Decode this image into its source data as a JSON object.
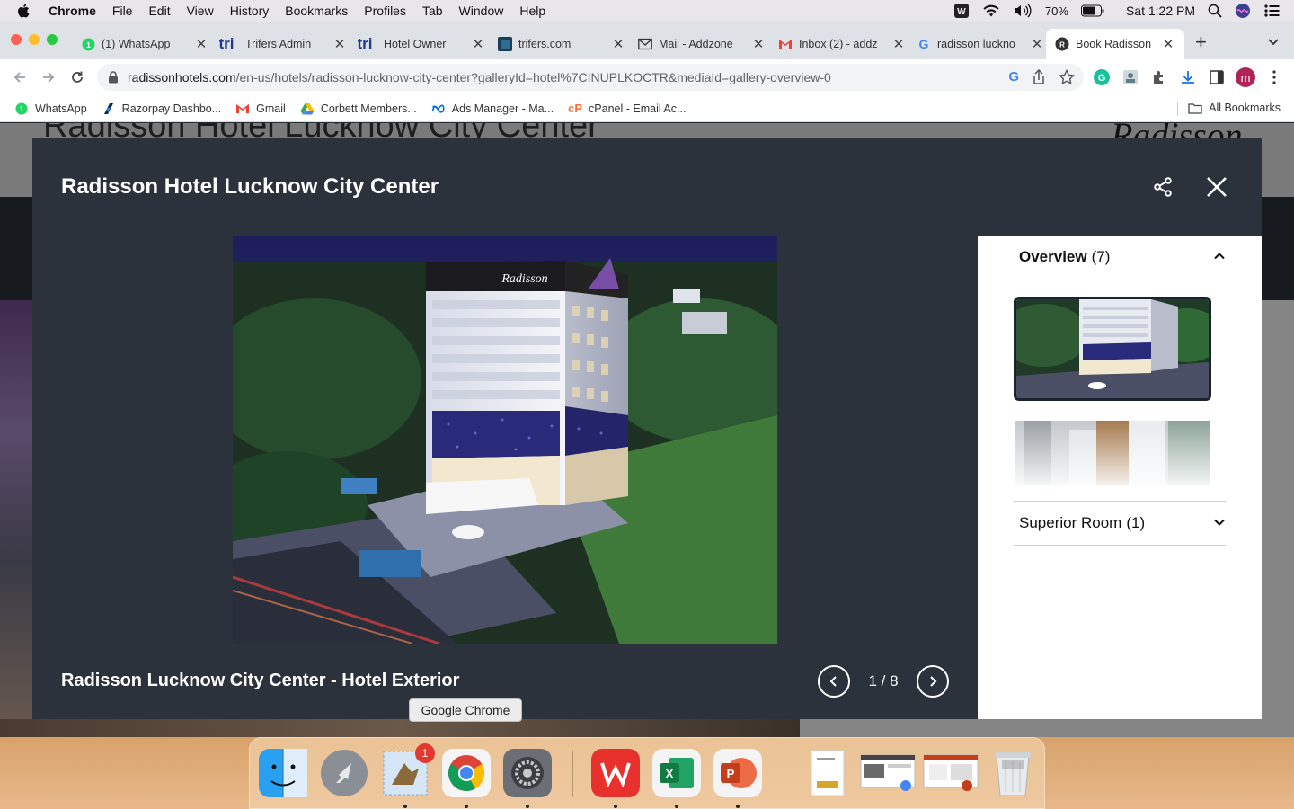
{
  "menubar": {
    "app": "Chrome",
    "items": [
      "File",
      "Edit",
      "View",
      "History",
      "Bookmarks",
      "Profiles",
      "Tab",
      "Window",
      "Help"
    ],
    "battery": "70%",
    "clock": "Sat 1:22 PM"
  },
  "tabs": [
    {
      "label": "(1) WhatsApp",
      "icon": "whatsapp-icon"
    },
    {
      "label": "Trifers Admin",
      "icon": "trifers-icon"
    },
    {
      "label": "Hotel Owner",
      "icon": "trifers-icon"
    },
    {
      "label": "trifers.com",
      "icon": "trifers-site-icon"
    },
    {
      "label": "Mail - Addzone",
      "icon": "mail-icon"
    },
    {
      "label": "Inbox (2) - addz",
      "icon": "gmail-icon"
    },
    {
      "label": "radisson luckno",
      "icon": "google-icon"
    },
    {
      "label": "Book Radisson",
      "icon": "radisson-icon",
      "active": true
    }
  ],
  "toolbar": {
    "url_host": "radissonhotels.com",
    "url_path": "/en-us/hotels/radisson-lucknow-city-center?galleryId=hotel%7CINUPLKOCTR&mediaId=gallery-overview-0",
    "profile_initial": "m"
  },
  "bookmarks": [
    {
      "label": "WhatsApp",
      "icon": "whatsapp-icon"
    },
    {
      "label": "Razorpay Dashbo...",
      "icon": "razorpay-icon"
    },
    {
      "label": "Gmail",
      "icon": "gmail-icon"
    },
    {
      "label": "Corbett Members...",
      "icon": "google-drive-icon"
    },
    {
      "label": "Ads Manager - Ma...",
      "icon": "meta-icon"
    },
    {
      "label": "cPanel - Email Ac...",
      "icon": "cpanel-icon"
    }
  ],
  "all_bookmarks": "All Bookmarks",
  "background_page": {
    "title": "Radisson Hotel Lucknow City Center",
    "logo": "Radisson"
  },
  "modal": {
    "title": "Radisson Hotel Lucknow City Center",
    "photo_sign": "Radisson",
    "caption": "Radisson Lucknow City Center - Hotel Exterior",
    "counter": "1 / 8",
    "sections": [
      {
        "name": "Overview",
        "count": "(7)",
        "expanded": true
      },
      {
        "name": "Superior Room",
        "count": "(1)",
        "expanded": false
      }
    ]
  },
  "tooltip": "Google Chrome",
  "dock": {
    "apps": [
      "Finder",
      "Launchpad",
      "Mail",
      "Google Chrome",
      "System Preferences",
      "WPS Office",
      "Microsoft Excel",
      "Microsoft PowerPoint"
    ],
    "mail_badge": "1"
  },
  "colors": {
    "modal_bg": "#2b323c",
    "panel_bg": "#ffffff",
    "text_light": "#ffffff",
    "tab_strip": "#dee1e6"
  }
}
